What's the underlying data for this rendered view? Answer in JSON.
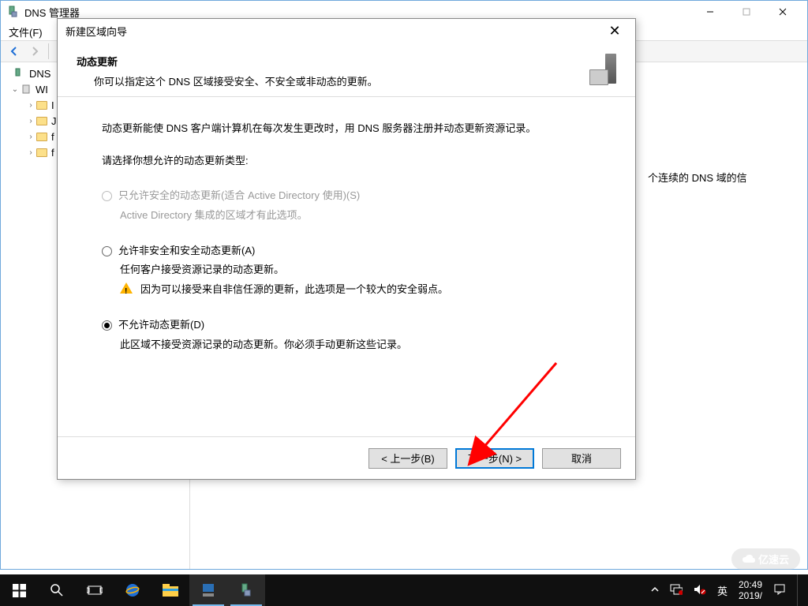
{
  "mgr": {
    "title": "DNS 管理器",
    "menu_file": "文件(F)",
    "tree": {
      "root": "DNS",
      "server": "WI",
      "items": [
        "I",
        "J",
        "f",
        "f"
      ]
    },
    "pane_hint_suffix": "个连续的 DNS 域的信"
  },
  "wizard": {
    "title": "新建区域向导",
    "heading": "动态更新",
    "subheading": "你可以指定这个 DNS 区域接受安全、不安全或非动态的更新。",
    "intro": "动态更新能使 DNS 客户端计算机在每次发生更改时，用 DNS 服务器注册并动态更新资源记录。",
    "prompt": "请选择你想允许的动态更新类型:",
    "opt1": {
      "label": "只允许安全的动态更新(适合 Active Directory 使用)(S)",
      "desc": "Active Directory 集成的区域才有此选项。"
    },
    "opt2": {
      "label": "允许非安全和安全动态更新(A)",
      "desc": "任何客户接受资源记录的动态更新。",
      "warn": "因为可以接受来自非信任源的更新，此选项是一个较大的安全弱点。"
    },
    "opt3": {
      "label": "不允许动态更新(D)",
      "desc": "此区域不接受资源记录的动态更新。你必须手动更新这些记录。"
    },
    "back": "< 上一步(B)",
    "next": "下一步(N) >",
    "cancel": "取消"
  },
  "taskbar": {
    "ime": "英",
    "time": "20:49",
    "date": "2019/"
  },
  "watermark": "亿速云"
}
